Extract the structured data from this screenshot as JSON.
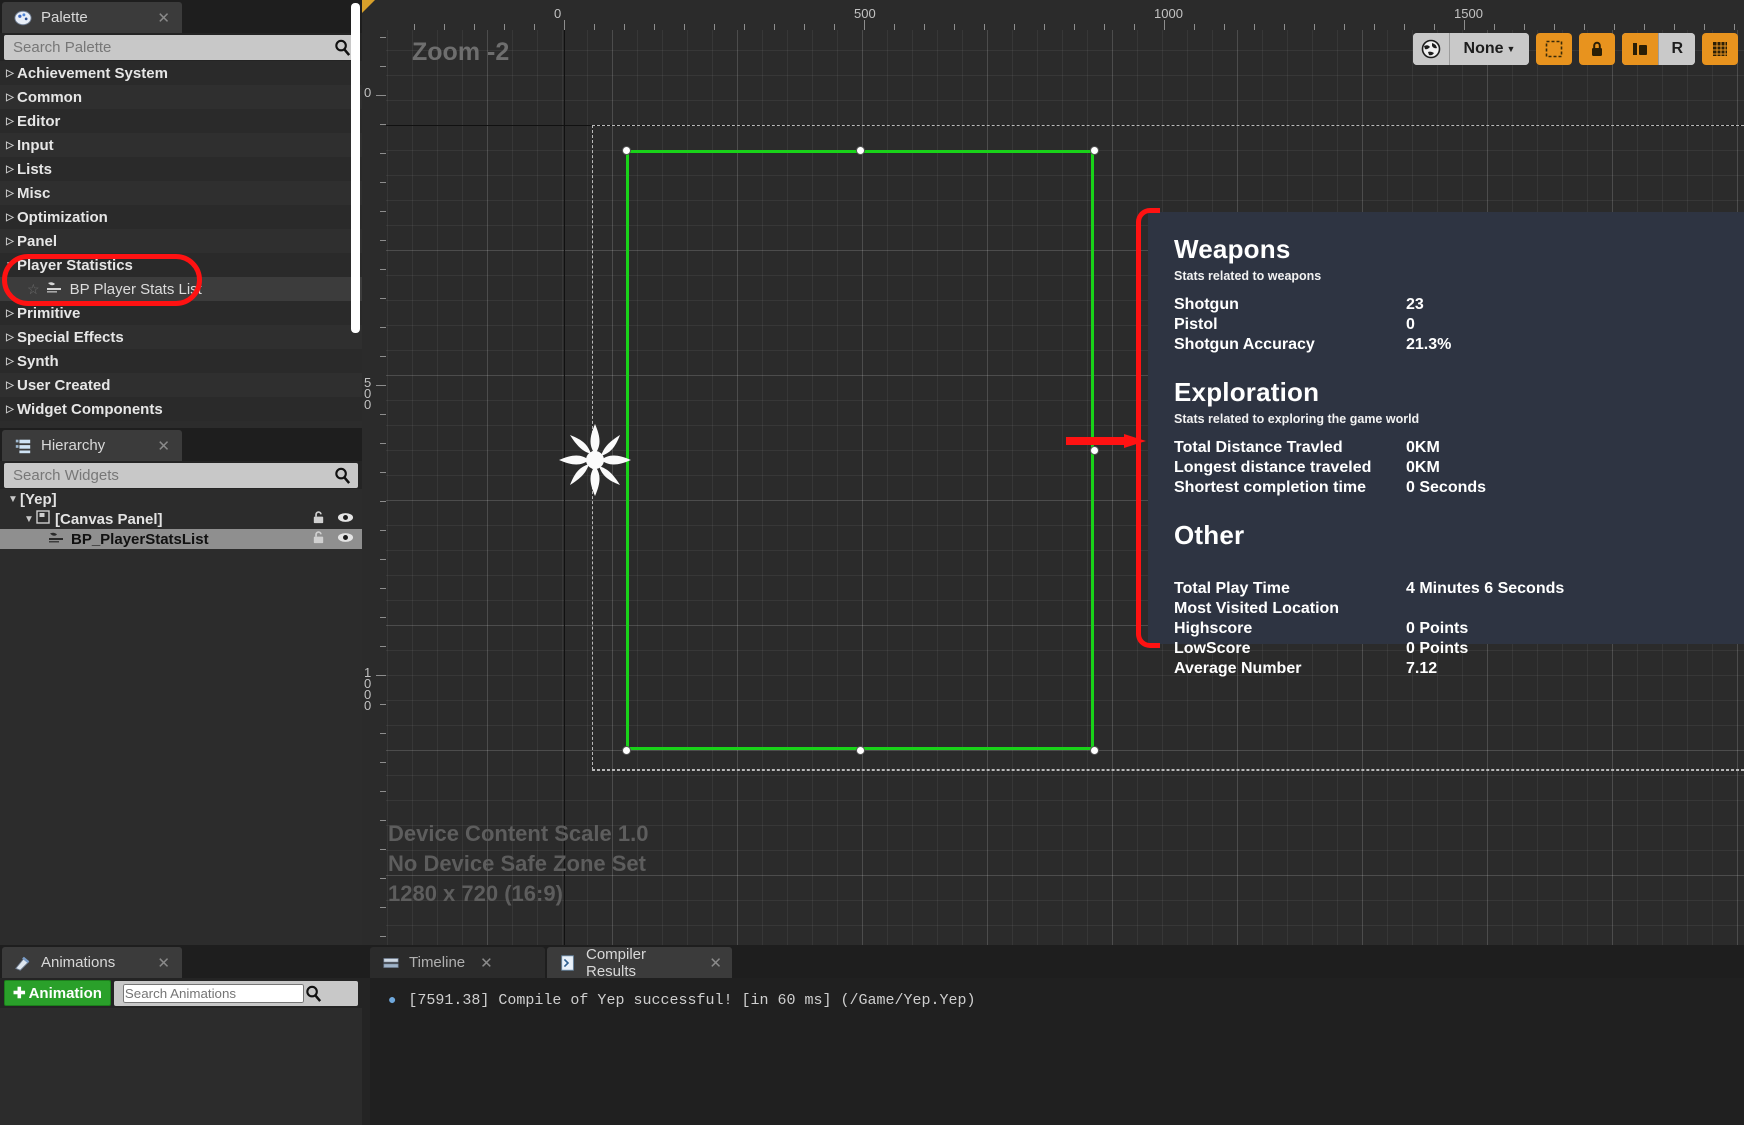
{
  "palette": {
    "tab_label": "Palette",
    "tab_icon": "palette-icon",
    "search_placeholder": "Search Palette",
    "categories": [
      {
        "label": "Achievement System",
        "expanded": false
      },
      {
        "label": "Common",
        "expanded": false
      },
      {
        "label": "Editor",
        "expanded": false
      },
      {
        "label": "Input",
        "expanded": false
      },
      {
        "label": "Lists",
        "expanded": false
      },
      {
        "label": "Misc",
        "expanded": false
      },
      {
        "label": "Optimization",
        "expanded": false
      },
      {
        "label": "Panel",
        "expanded": false
      },
      {
        "label": "Player Statistics",
        "expanded": true
      },
      {
        "label": "Primitive",
        "expanded": false
      },
      {
        "label": "Special Effects",
        "expanded": false
      },
      {
        "label": "Synth",
        "expanded": false
      },
      {
        "label": "User Created",
        "expanded": false
      },
      {
        "label": "Widget Components",
        "expanded": false
      }
    ],
    "child_item": "BP Player Stats List"
  },
  "hierarchy": {
    "tab_label": "Hierarchy",
    "search_placeholder": "Search Widgets",
    "items": [
      {
        "label": "[Yep]",
        "depth": 0,
        "selected": false,
        "has_icons": false
      },
      {
        "label": "[Canvas Panel]",
        "depth": 1,
        "selected": false,
        "has_icons": true
      },
      {
        "label": "BP_PlayerStatsList",
        "depth": 2,
        "selected": true,
        "has_icons": true
      }
    ]
  },
  "animations": {
    "tab_label": "Animations",
    "add_button": "Animation",
    "search_placeholder": "Search Animations"
  },
  "designer": {
    "zoom_label": "Zoom -2",
    "device_lines": [
      "Device Content Scale 1.0",
      "No Device Safe Zone Set",
      "1280 x 720 (16:9)"
    ],
    "h_ruler_labels": [
      "0",
      "500",
      "1000",
      "1500"
    ],
    "v_ruler_labels": [
      "0",
      "500",
      "1000"
    ],
    "toolbar": {
      "globe_icon": "globe-icon",
      "selection_label": "None",
      "dashed_box_icon": "dashed-box-icon",
      "lock_icon": "lock-icon",
      "layout_icon": "layout-icon",
      "rotate_label": "R",
      "grid_icon": "grid-icon"
    }
  },
  "stats_widget": {
    "sections": [
      {
        "title": "Weapons",
        "subtitle": "Stats related to weapons",
        "rows": [
          {
            "label": "Shotgun",
            "value": "23"
          },
          {
            "label": "Pistol",
            "value": "0"
          },
          {
            "label": "Shotgun Accuracy",
            "value": "21.3%"
          }
        ]
      },
      {
        "title": "Exploration",
        "subtitle": "Stats related to exploring the game world",
        "rows": [
          {
            "label": "Total Distance Travled",
            "value": "0KM"
          },
          {
            "label": "Longest distance traveled",
            "value": "0KM"
          },
          {
            "label": "Shortest completion time",
            "value": "0 Seconds"
          }
        ]
      },
      {
        "title": "Other",
        "subtitle": "",
        "rows": [
          {
            "label": "Total Play Time",
            "value": "4 Minutes 6 Seconds"
          },
          {
            "label": "Most Visited Location",
            "value": ""
          },
          {
            "label": "Highscore",
            "value": "0 Points"
          },
          {
            "label": "LowScore",
            "value": "0 Points"
          },
          {
            "label": "Average Number",
            "value": "7.12"
          }
        ]
      }
    ]
  },
  "bottom_dock": {
    "tabs": [
      {
        "label": "Timeline",
        "active": false
      },
      {
        "label": "Compiler Results",
        "active": true
      }
    ],
    "log": "[7591.38] Compile of Yep successful! [in 60 ms] (/Game/Yep.Yep)"
  },
  "colors": {
    "accent_orange": "#e8931e",
    "selection_green": "#19d219",
    "highlight_red": "#ff1212",
    "widget_bg": "#2e3442"
  }
}
